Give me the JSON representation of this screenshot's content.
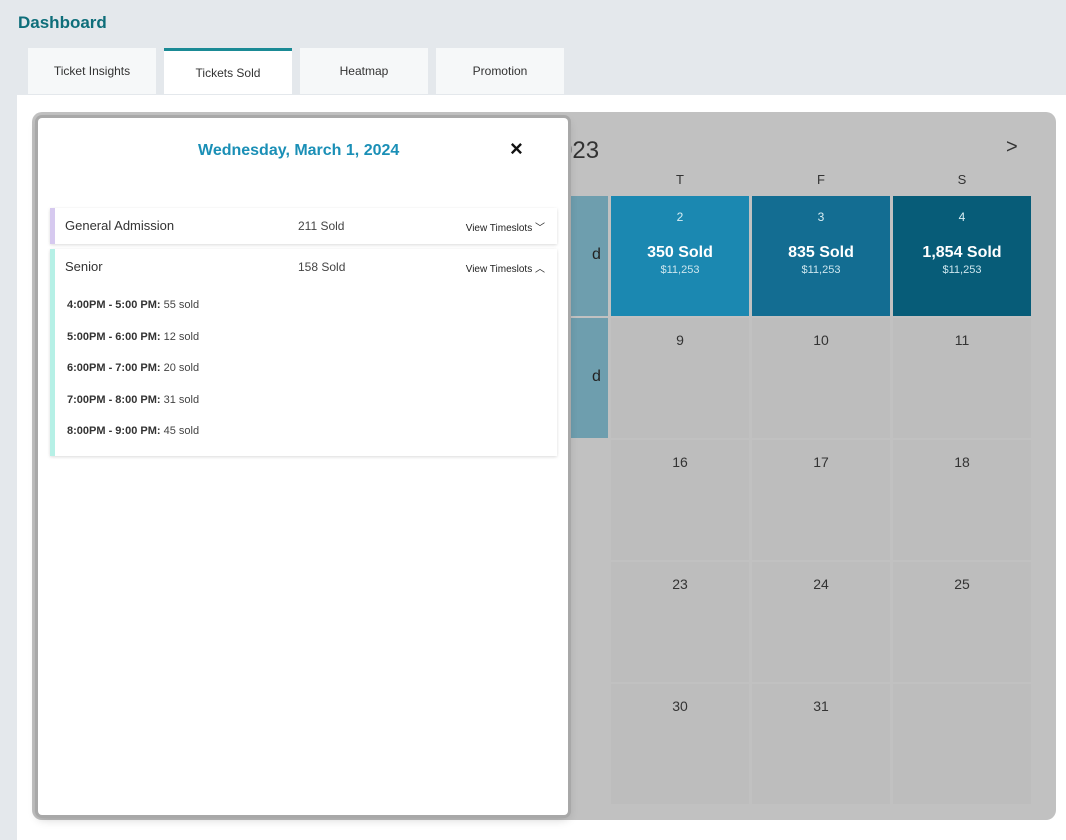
{
  "app": {
    "title": "Dashboard"
  },
  "tabs": [
    {
      "label": "Ticket Insights"
    },
    {
      "label": "Tickets Sold"
    },
    {
      "label": "Heatmap"
    },
    {
      "label": "Promotion"
    }
  ],
  "calendar": {
    "title_fragment": "023",
    "next_label": ">",
    "weekdays": [
      "T",
      "F",
      "S"
    ],
    "partial_label": "d",
    "row1": [
      {
        "day": "2",
        "sold": "350 Sold",
        "revenue": "$11,253",
        "color": "#1b88b1"
      },
      {
        "day": "3",
        "sold": "835 Sold",
        "revenue": "$11,253",
        "color": "#136d92"
      },
      {
        "day": "4",
        "sold": "1,854 Sold",
        "revenue": "$11,253",
        "color": "#075c78"
      }
    ],
    "row2": [
      "9",
      "10",
      "11"
    ],
    "row3": [
      "16",
      "17",
      "18"
    ],
    "row4": [
      "23",
      "24",
      "25"
    ],
    "row5": [
      "30",
      "31",
      ""
    ]
  },
  "dialog": {
    "title": "Wednesday, March 1, 2024",
    "close_icon": "×",
    "tickets": [
      {
        "name": "General Admission",
        "sold": "211 Sold",
        "toggle": "View Timeslots",
        "chevron": "﹀",
        "bar_color": "#d6c9ef"
      },
      {
        "name": "Senior",
        "sold": "158 Sold",
        "toggle": "View Timeslots",
        "chevron": "︿",
        "bar_color": "#b6f0e6"
      }
    ],
    "timeslots": [
      {
        "time": "4:00PM - 5:00 PM:",
        "count": "55 sold"
      },
      {
        "time": "5:00PM - 6:00 PM:",
        "count": "12 sold"
      },
      {
        "time": "6:00PM - 7:00 PM:",
        "count": "20 sold"
      },
      {
        "time": "7:00PM - 8:00 PM:",
        "count": "31 sold"
      },
      {
        "time": "8:00PM - 9:00 PM:",
        "count": "45 sold"
      }
    ]
  }
}
